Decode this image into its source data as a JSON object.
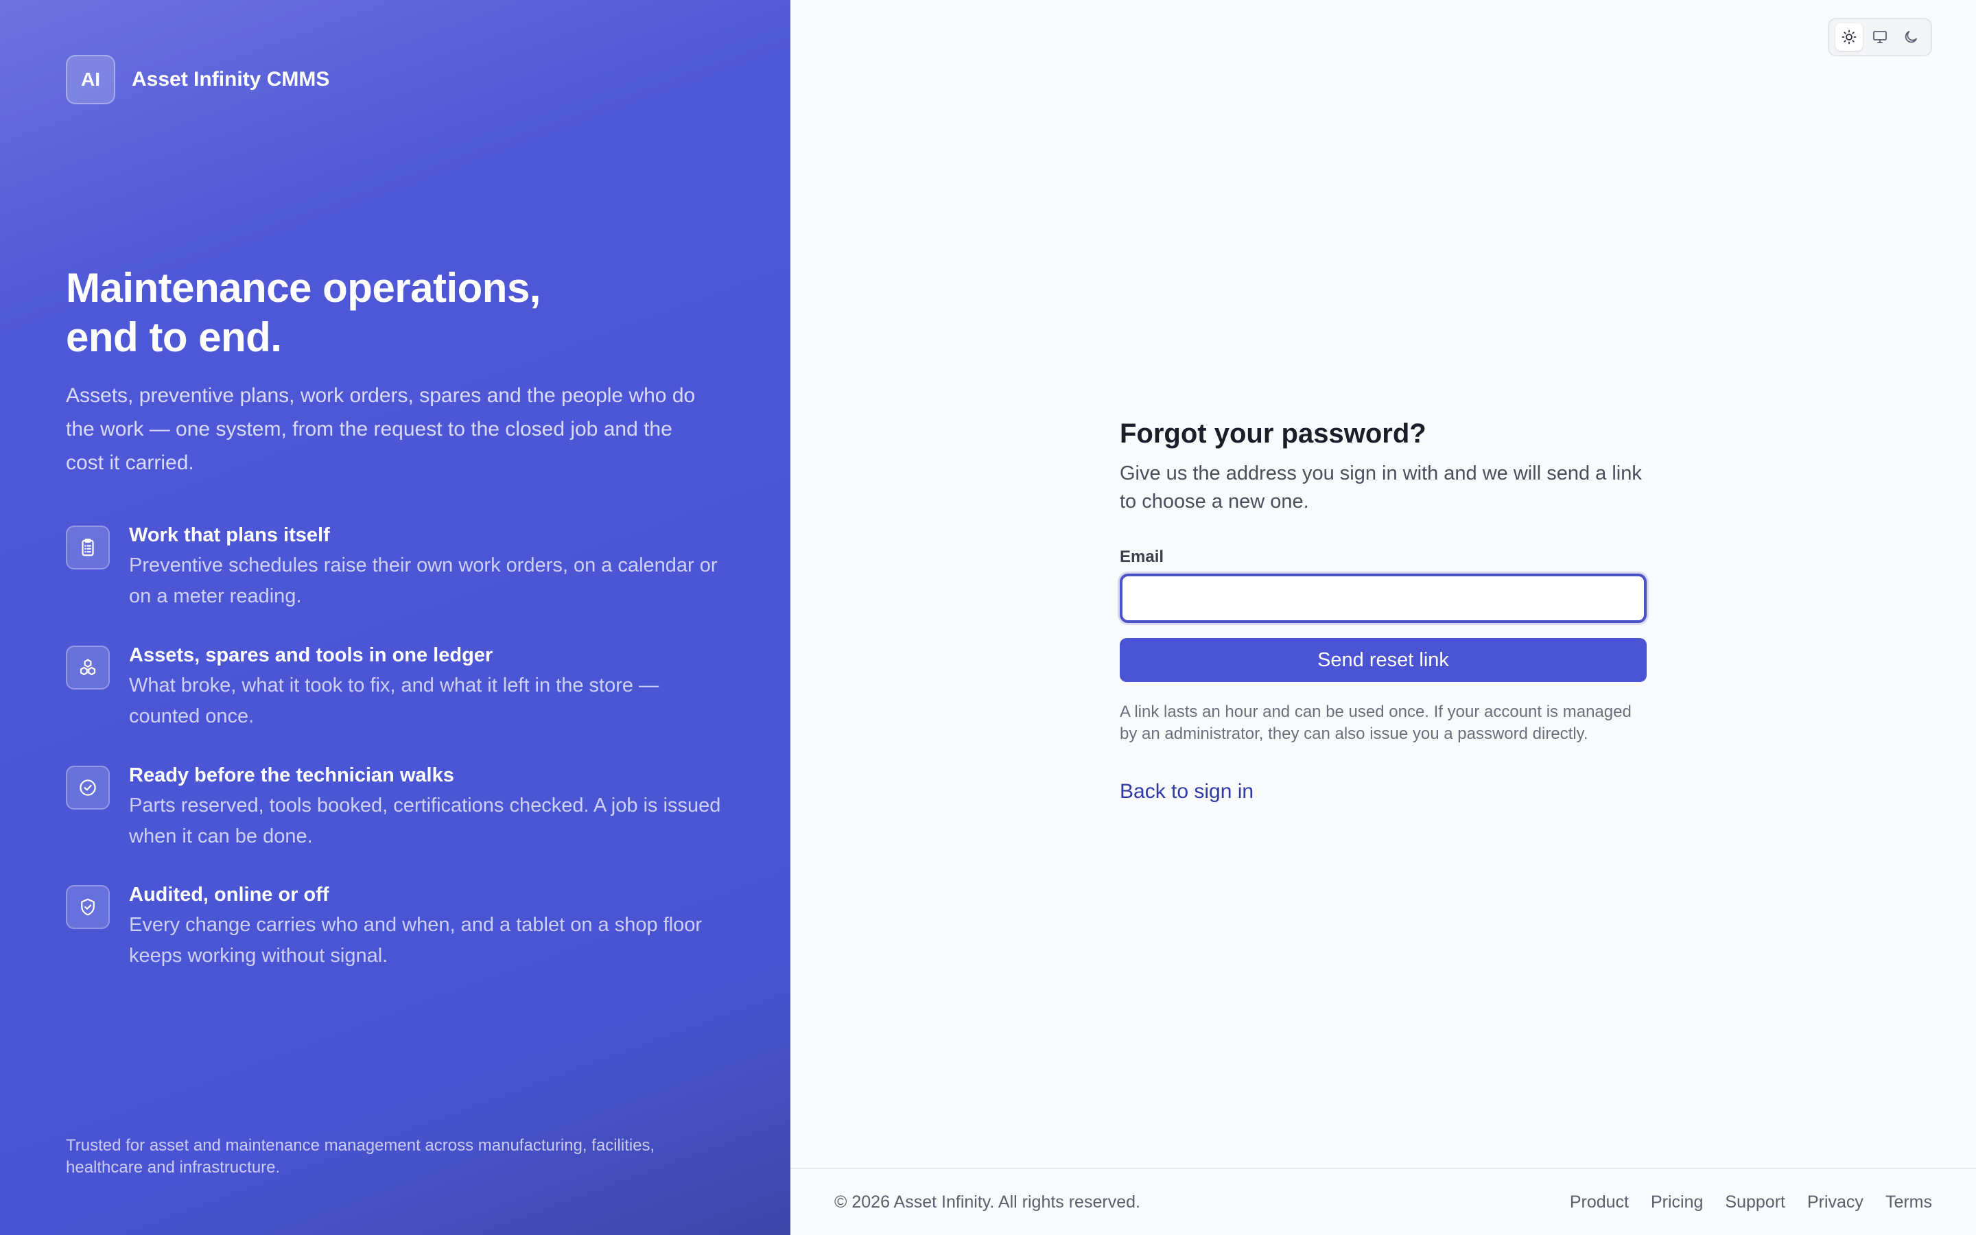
{
  "brand": {
    "badge": "AI",
    "name": "Asset Infinity CMMS"
  },
  "hero": {
    "title_line1": "Maintenance operations,",
    "title_line2": "end to end.",
    "subtitle": "Assets, preventive plans, work orders, spares and the people who do the work — one system, from the request to the closed job and the cost it carried."
  },
  "features": [
    {
      "icon": "clipboard-list-icon",
      "title": "Work that plans itself",
      "description": "Preventive schedules raise their own work orders, on a calendar or on a meter reading."
    },
    {
      "icon": "boxes-icon",
      "title": "Assets, spares and tools in one ledger",
      "description": "What broke, what it took to fix, and what it left in the store — counted once."
    },
    {
      "icon": "check-circle-icon",
      "title": "Ready before the technician walks",
      "description": "Parts reserved, tools booked, certifications checked. A job is issued when it can be done."
    },
    {
      "icon": "shield-check-icon",
      "title": "Audited, online or off",
      "description": "Every change carries who and when, and a tablet on a shop floor keeps working without signal."
    }
  ],
  "trusted": "Trusted for asset and maintenance management across manufacturing, facilities, healthcare and infrastructure.",
  "theme_switch": {
    "options": [
      "sun-icon",
      "monitor-icon",
      "moon-icon"
    ],
    "selected": "sun-icon"
  },
  "form": {
    "title": "Forgot your password?",
    "subtitle": "Give us the address you sign in with and we will send a link to choose a new one.",
    "email_label": "Email",
    "email_value": "",
    "submit_label": "Send reset link",
    "note": "A link lasts an hour and can be used once. If your account is managed by an administrator, they can also issue you a password directly.",
    "back_link": "Back to sign in"
  },
  "footer": {
    "copyright": "© 2026 Asset Infinity. All rights reserved.",
    "links": [
      "Product",
      "Pricing",
      "Support",
      "Privacy",
      "Terms"
    ]
  },
  "colors": {
    "brand_primary": "#4b55d3",
    "link": "#2f3aa6",
    "page_bg": "#f9fafb"
  }
}
